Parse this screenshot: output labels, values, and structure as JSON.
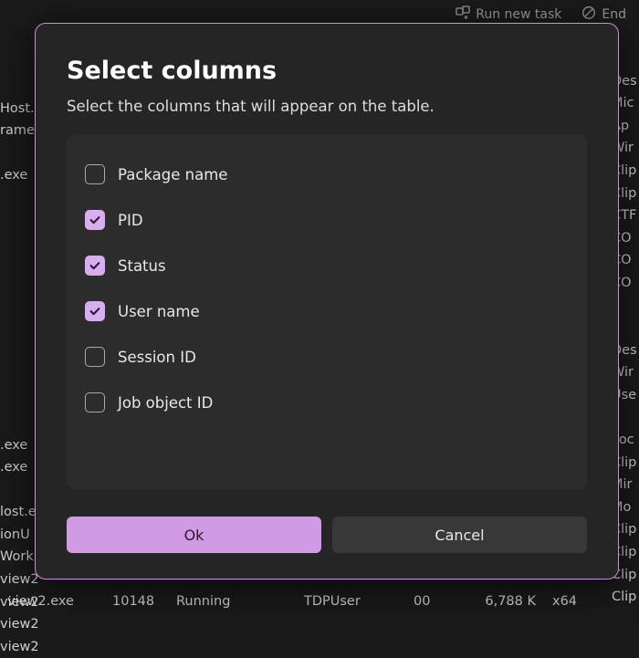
{
  "topbar": {
    "run_new_task": "Run new task",
    "end_task": "End"
  },
  "bg": {
    "left_fragments": [
      "",
      "Host.e",
      "rame",
      "",
      ".exe",
      "",
      "",
      "",
      "",
      "",
      "",
      "",
      "",
      "",
      "",
      "",
      ".exe",
      ".exe",
      "",
      "lost.e",
      "ionU",
      "Work",
      "view2",
      "view2",
      "view2",
      "view2"
    ],
    "right_fragments": [
      "",
      "Des",
      "Mic",
      "Ap",
      "Wir",
      "Clip",
      "Clip",
      "CTF",
      "CO",
      "CO",
      "CO",
      "",
      "",
      "Des",
      "Wir",
      "Use",
      "",
      "Loc",
      "Clip",
      "Mir",
      "Mo",
      "Clip",
      "Clip",
      "Clip",
      "Clip"
    ],
    "row": {
      "name": "view2.exe",
      "pid": "10148",
      "status": "Running",
      "user": "TDPUser",
      "session": "00",
      "mem": "6,788 K",
      "arch": "x64"
    }
  },
  "dialog": {
    "title": "Select columns",
    "subtitle": "Select the columns that will appear on the table.",
    "options": [
      {
        "key": "package-name",
        "label": "Package name",
        "checked": false
      },
      {
        "key": "pid",
        "label": "PID",
        "checked": true
      },
      {
        "key": "status",
        "label": "Status",
        "checked": true
      },
      {
        "key": "user-name",
        "label": "User name",
        "checked": true
      },
      {
        "key": "session-id",
        "label": "Session ID",
        "checked": false
      },
      {
        "key": "job-object-id",
        "label": "Job object ID",
        "checked": false
      }
    ],
    "ok_label": "Ok",
    "cancel_label": "Cancel"
  }
}
